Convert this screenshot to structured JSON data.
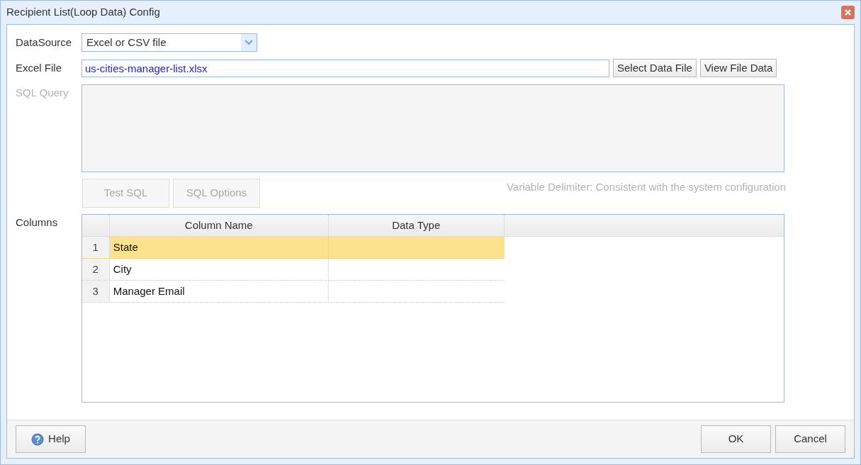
{
  "window": {
    "title": "Recipient List(Loop Data) Config"
  },
  "datasource": {
    "label": "DataSource",
    "value": "Excel or CSV file"
  },
  "excel_file": {
    "label": "Excel File",
    "value": "us-cities-manager-list.xlsx"
  },
  "file_buttons": [
    {
      "label": "Select Data File",
      "disabled": false
    },
    {
      "label": "View File Data",
      "disabled": false
    }
  ],
  "sql_query": {
    "label": "SQL Query",
    "disabled": true
  },
  "sql_buttons": [
    {
      "label": "Test SQL",
      "disabled": true
    },
    {
      "label": "SQL Options",
      "disabled": true
    }
  ],
  "variable_delimiter": {
    "text": "Variable Delimiter: Consistent with the system configuration",
    "disabled": true
  },
  "columns": {
    "label": "Columns",
    "headers": [
      "Column Name",
      "Data Type"
    ],
    "rows": [
      {
        "number": "1",
        "name": "State",
        "selected": true
      },
      {
        "number": "2",
        "name": "City",
        "selected": false
      },
      {
        "number": "3",
        "name": "Manager Email",
        "selected": false
      }
    ]
  },
  "footer": {
    "help": "Help",
    "ok": "OK",
    "cancel": "Cancel"
  }
}
